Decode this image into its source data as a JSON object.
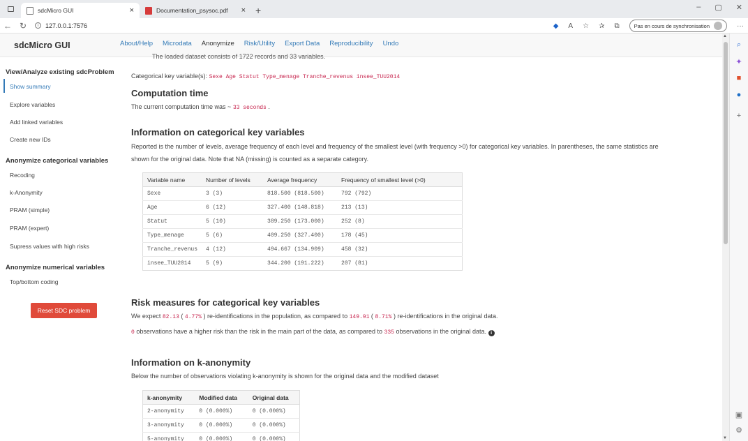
{
  "browser": {
    "tabs": [
      {
        "title": "sdcMicro GUI",
        "close": "×"
      },
      {
        "title": "Documentation_psysoc.pdf",
        "close": "×"
      }
    ],
    "new_tab": "+",
    "url": "127.0.0.1:7576",
    "sync_label": "Pas en cours de synchronisation",
    "window_controls": [
      "–",
      "▢",
      "✕"
    ]
  },
  "app": {
    "brand": "sdcMicro GUI",
    "menu": [
      "About/Help",
      "Microdata",
      "Anonymize",
      "Risk/Utility",
      "Export Data",
      "Reproducibility",
      "Undo"
    ],
    "header_overflow": "The loaded dataset consists of 1722 records and 33 variables."
  },
  "sidebar": {
    "section1_title": "View/Analyze existing sdcProblem",
    "section1_items": [
      "Show summary",
      "Explore variables",
      "Add linked variables",
      "Create new IDs"
    ],
    "section2_title": "Anonymize categorical variables",
    "section2_items": [
      "Recoding",
      "k-Anonymity",
      "PRAM (simple)",
      "PRAM (expert)",
      "Supress values with high risks"
    ],
    "section3_title": "Anonymize numerical variables",
    "section3_items": [
      "Top/bottom coding"
    ],
    "reset_button": "Reset SDC problem"
  },
  "main": {
    "key_vars_label": "Categorical key variable(s):",
    "key_vars_value": "Sexe Age Statut Type_menage Tranche_revenus insee_TUU2014",
    "computation_title": "Computation time",
    "computation_text": "The current computation time was ~",
    "computation_value": "33 seconds",
    "computation_end": ".",
    "cat_title": "Information on categorical key variables",
    "cat_text_1": "Reported is the number of levels, average frequency of each level and frequency of the smallest level (with frequency >0) for categorical key variables. In parentheses, the same statistics are",
    "cat_text_2": "shown for the original data. Note that NA (missing) is counted as a separate category.",
    "cat_table": {
      "headers": [
        "Variable name",
        "Number of levels",
        "Average frequency",
        "Frequency of smallest level (>0)"
      ],
      "rows": [
        [
          "Sexe",
          "3 (3)",
          "818.500 (818.500)",
          "792 (792)"
        ],
        [
          "Age",
          "6 (12)",
          "327.400 (148.818)",
          "213 (13)"
        ],
        [
          "Statut",
          "5 (10)",
          "389.250 (173.000)",
          "252 (8)"
        ],
        [
          "Type_menage",
          "5 (6)",
          "409.250 (327.400)",
          "178 (45)"
        ],
        [
          "Tranche_revenus",
          "4 (12)",
          "494.667 (134.909)",
          "458 (32)"
        ],
        [
          "insee_TUU2014",
          "5 (9)",
          "344.200 (191.222)",
          "207 (81)"
        ]
      ]
    },
    "risk_title": "Risk measures for categorical key variables",
    "risk_line1": [
      "We expect",
      "82.13",
      "(",
      "4.77%",
      ") re-identifications in the population, as compared to",
      "149.91",
      "(",
      "8.71%",
      ") re-identifications in the original data."
    ],
    "risk_line2": [
      "0",
      "observations have a higher risk than the risk in the main part of the data, as compared to",
      "335",
      "observations in the original data."
    ],
    "kanon_title": "Information on k-anonymity",
    "kanon_text": "Below the number of observations violating k-anonymity is shown for the original data and the modified dataset",
    "kanon_table": {
      "headers": [
        "k-anonymity",
        "Modified data",
        "Original data"
      ],
      "rows": [
        [
          "2-anonymity",
          "0 (0.000%)",
          "0 (0.000%)"
        ],
        [
          "3-anonymity",
          "0 (0.000%)",
          "0 (0.000%)"
        ],
        [
          "5-anonymity",
          "0 (0.000%)",
          "0 (0.000%)"
        ]
      ]
    }
  }
}
